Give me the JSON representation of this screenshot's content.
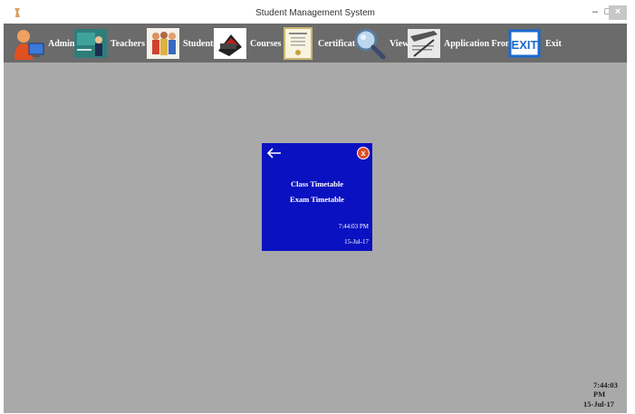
{
  "window": {
    "title": "Student Management System",
    "controls": {
      "minimize": "–",
      "maximize": "□",
      "close": "×"
    }
  },
  "toolbar": {
    "items": [
      {
        "label": "Admin",
        "icon": "admin-icon"
      },
      {
        "label": "Teachers",
        "icon": "teachers-icon"
      },
      {
        "label": "Students",
        "icon": "students-icon"
      },
      {
        "label": "Courses",
        "icon": "courses-icon"
      },
      {
        "label": "Certificates",
        "icon": "certificate-icon"
      },
      {
        "label": "View",
        "icon": "magnifier-icon"
      },
      {
        "label": "Application From",
        "icon": "application-form-icon"
      },
      {
        "label": "Exit",
        "icon": "exit-icon"
      }
    ]
  },
  "popup": {
    "links": [
      "Class Timetable",
      "Exam Timetable"
    ],
    "time": "7:44:03 PM",
    "date": "15-Jul-17",
    "close_glyph": "x"
  },
  "status": {
    "time": "7:44:03 PM",
    "date": "15-Jul-17"
  },
  "colors": {
    "background": "#a9a9a9",
    "toolbar": "#6b6b6b",
    "popup": "#0a11c0"
  }
}
